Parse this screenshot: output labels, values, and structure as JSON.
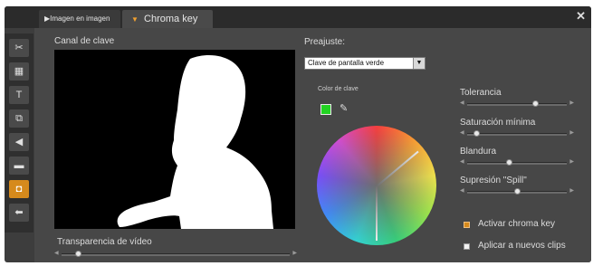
{
  "tabs": {
    "tab1_label": "Imagen en imagen",
    "tab2_label": "Chroma key",
    "close_glyph": "✕"
  },
  "toolbar": {
    "items": [
      {
        "icon": "scissors-icon",
        "glyph": "✂",
        "active": false
      },
      {
        "icon": "image-icon",
        "glyph": "▦",
        "active": false
      },
      {
        "icon": "text-icon",
        "glyph": "T",
        "active": false
      },
      {
        "icon": "effects-icon",
        "glyph": "⧉",
        "active": false
      },
      {
        "icon": "audio-icon",
        "glyph": "◀",
        "active": false
      },
      {
        "icon": "clapperboard-icon",
        "glyph": "▬",
        "active": false
      },
      {
        "icon": "chroma-key-icon",
        "glyph": "◘",
        "active": true
      },
      {
        "icon": "plugin-icon",
        "glyph": "⬅",
        "active": false
      }
    ]
  },
  "preview": {
    "label": "Canal de clave"
  },
  "transparency": {
    "label": "Transparencia de vídeo",
    "value": 0.06
  },
  "preset": {
    "label": "Preajuste:",
    "selected": "Clave de pantalla verde"
  },
  "key_color": {
    "label": "Color de clave",
    "color": "#22d322"
  },
  "sliders": {
    "tolerance": {
      "label": "Tolerancia",
      "value": 0.7
    },
    "min_saturation": {
      "label": "Saturación mínima",
      "value": 0.07
    },
    "softness": {
      "label": "Blandura",
      "value": 0.42
    },
    "spill": {
      "label": "Supresión \"Spill\"",
      "value": 0.5
    }
  },
  "options": {
    "activate_label": "Activar chroma key",
    "activate_checked": true,
    "apply_label": "Aplicar a nuevos clips",
    "apply_checked": false
  },
  "colors": {
    "accent": "#d68a1c",
    "panel": "#474747"
  }
}
